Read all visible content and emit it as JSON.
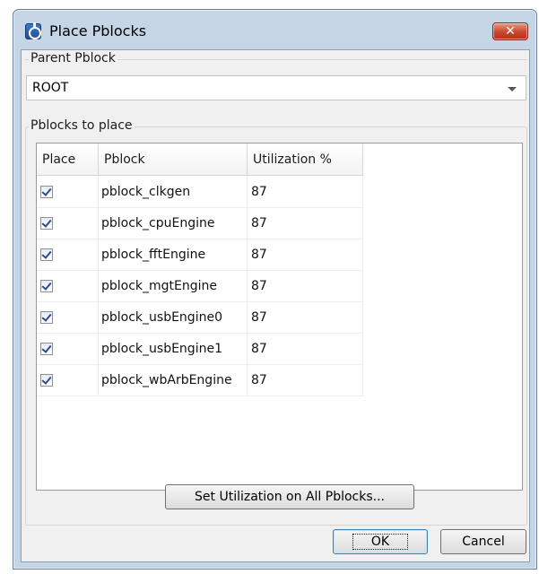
{
  "window": {
    "title": "Place Pblocks",
    "close_label": "✕"
  },
  "parent_pblock": {
    "label": "Parent Pblock",
    "selected": "ROOT"
  },
  "pblocks_to_place": {
    "label": "Pblocks to place",
    "columns": [
      "Place",
      "Pblock",
      "Utilization %"
    ],
    "rows": [
      {
        "checked": true,
        "pblock": "pblock_clkgen",
        "utilization": "87"
      },
      {
        "checked": true,
        "pblock": "pblock_cpuEngine",
        "utilization": "87"
      },
      {
        "checked": true,
        "pblock": "pblock_fftEngine",
        "utilization": "87"
      },
      {
        "checked": true,
        "pblock": "pblock_mgtEngine",
        "utilization": "87"
      },
      {
        "checked": true,
        "pblock": "pblock_usbEngine0",
        "utilization": "87"
      },
      {
        "checked": true,
        "pblock": "pblock_usbEngine1",
        "utilization": "87"
      },
      {
        "checked": true,
        "pblock": "pblock_wbArbEngine",
        "utilization": "87"
      }
    ]
  },
  "buttons": {
    "set_utilization": "Set Utilization on All Pblocks...",
    "ok": "OK",
    "cancel": "Cancel"
  },
  "icons": {
    "app": "app-icon",
    "close": "close-icon",
    "dropdown": "chevron-down-icon",
    "checkbox": "checkbox-checked-icon"
  }
}
